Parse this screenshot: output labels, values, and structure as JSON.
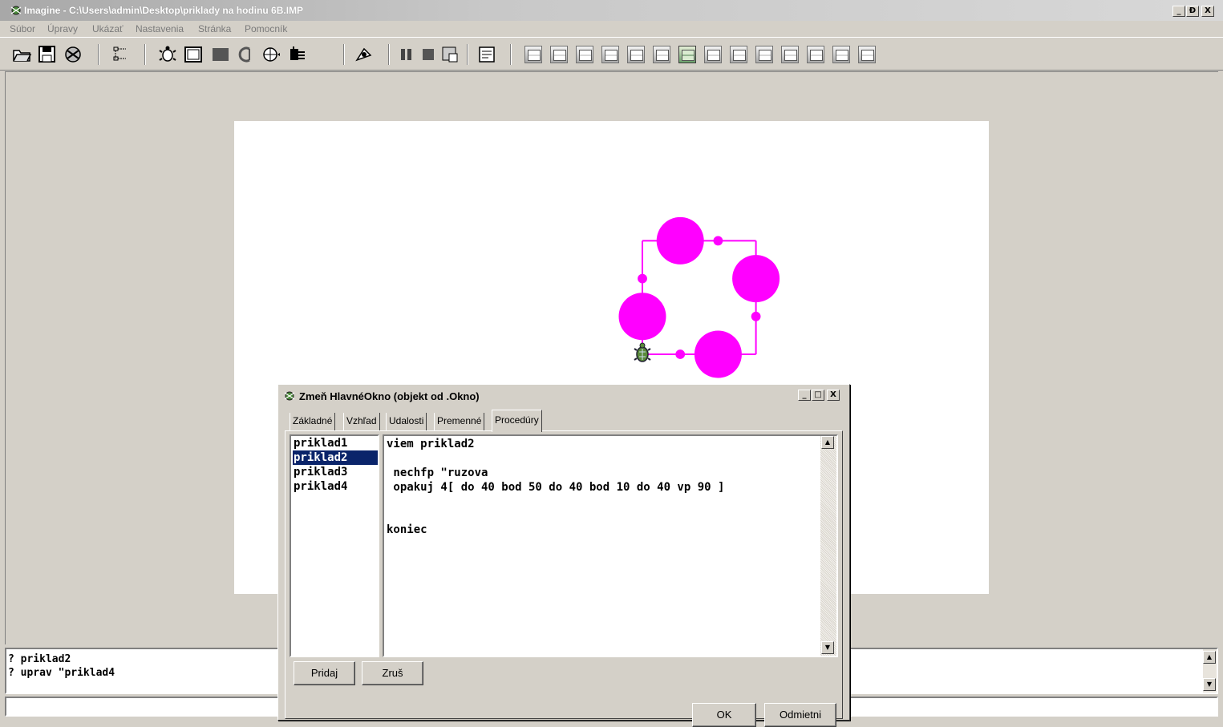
{
  "window": {
    "title": "Imagine - C:\\Users\\admin\\Desktop\\priklady na hodinu 6B.IMP",
    "controls": {
      "minimize": "_",
      "maximize": "Ɖ",
      "close": "X"
    }
  },
  "menu": [
    "Súbor",
    "Úpravy",
    "Ukázať",
    "Nastavenia",
    "Stránka",
    "Pomocník"
  ],
  "toolbar": {
    "icons": [
      "open-icon",
      "save-icon",
      "print-icon",
      "project-tree-icon",
      "turtle-icon",
      "frame-icon",
      "rectangle-icon",
      "text-icon",
      "slider-icon",
      "net-icon",
      "arrow-icon",
      "pause-icon",
      "stop-icon",
      "run-icon",
      "page-icon"
    ],
    "page_count": 14,
    "selected_page": 7
  },
  "canvas": {
    "pen_color": "#ff00ff",
    "turtle_program": {
      "sides": 4,
      "step": 40,
      "dot_small": 10,
      "dot_big": 50,
      "turn": 90
    }
  },
  "history": [
    "? priklad2",
    "? uprav \"priklad4"
  ],
  "command_line": "",
  "dialog": {
    "title": "Zmeň HlavnéOkno (objekt od .Okno)",
    "controls": {
      "minimize": "_",
      "maximize": "□",
      "close": "X"
    },
    "tabs": [
      "Základné",
      "Vzhľad",
      "Udalosti",
      "Premenné",
      "Procedúry"
    ],
    "active_tab": "Procedúry",
    "procedures": [
      "priklad1",
      "priklad2",
      "priklad3",
      "priklad4"
    ],
    "selected_procedure": "priklad2",
    "code": [
      "viem priklad2",
      "",
      " nechfp \"ruzova",
      " opakuj 4[ do 40 bod 50 do 40 bod 10 do 40 vp 90 ]",
      "",
      "",
      "koniec"
    ],
    "buttons": {
      "add": "Pridaj",
      "delete": "Zruš",
      "ok": "OK",
      "cancel": "Odmietni"
    }
  }
}
